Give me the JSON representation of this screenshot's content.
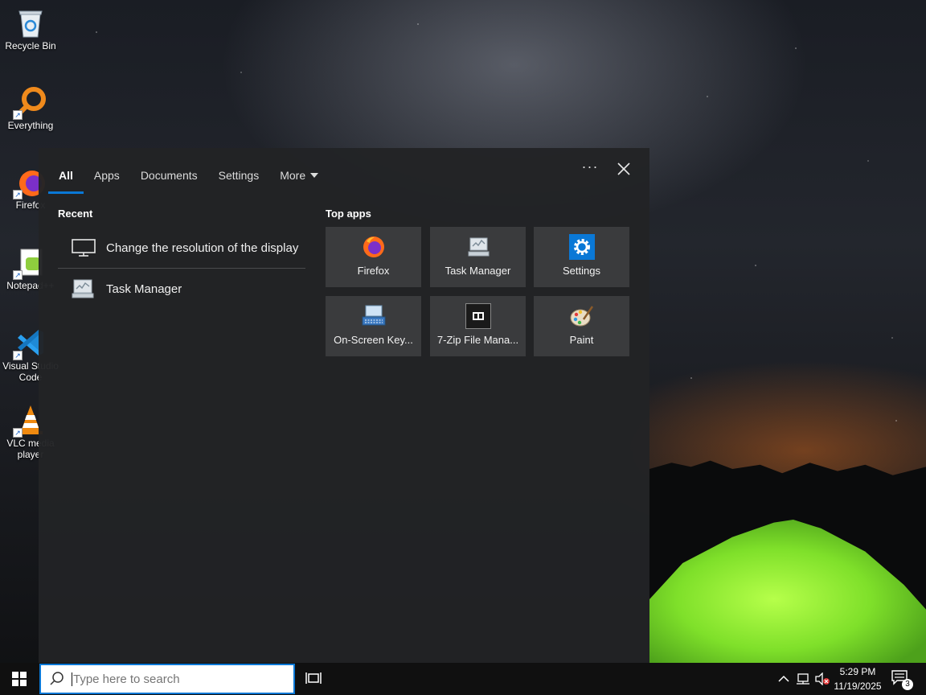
{
  "desktop": {
    "icons": [
      {
        "label": "Recycle Bin",
        "icon": "recycle-bin-icon"
      },
      {
        "label": "Everything",
        "icon": "everything-search-icon"
      },
      {
        "label": "Firefox",
        "icon": "firefox-icon"
      },
      {
        "label": "Notepad++",
        "icon": "notepad-plus-plus-icon"
      },
      {
        "label": "Visual Studio Code",
        "icon": "vscode-icon"
      },
      {
        "label": "VLC media player",
        "icon": "vlc-icon"
      }
    ]
  },
  "search_panel": {
    "tabs": [
      {
        "label": "All",
        "active": true
      },
      {
        "label": "Apps"
      },
      {
        "label": "Documents"
      },
      {
        "label": "Settings"
      },
      {
        "label": "More",
        "dropdown": true
      }
    ],
    "options_label": "···",
    "recent_title": "Recent",
    "recent": [
      {
        "label": "Change the resolution of the display",
        "icon": "monitor-icon"
      },
      {
        "label": "Task Manager",
        "icon": "task-manager-icon"
      }
    ],
    "top_apps_title": "Top apps",
    "top_apps": [
      {
        "label": "Firefox",
        "icon": "firefox-icon"
      },
      {
        "label": "Task Manager",
        "icon": "task-manager-icon"
      },
      {
        "label": "Settings",
        "icon": "settings-gear-icon"
      },
      {
        "label": "On-Screen Key...",
        "icon": "onscreen-keyboard-icon"
      },
      {
        "label": "7-Zip File Mana...",
        "icon": "7zip-icon"
      },
      {
        "label": "Paint",
        "icon": "paint-palette-icon"
      }
    ]
  },
  "taskbar": {
    "search_placeholder": "Type here to search",
    "time": "5:29 PM",
    "date": "11/19/2025",
    "notification_count": "3"
  },
  "colors": {
    "accent": "#0a78d6",
    "panel_bg": "#222325",
    "tile_bg": "#3a3b3d",
    "taskbar_bg": "#101010"
  }
}
